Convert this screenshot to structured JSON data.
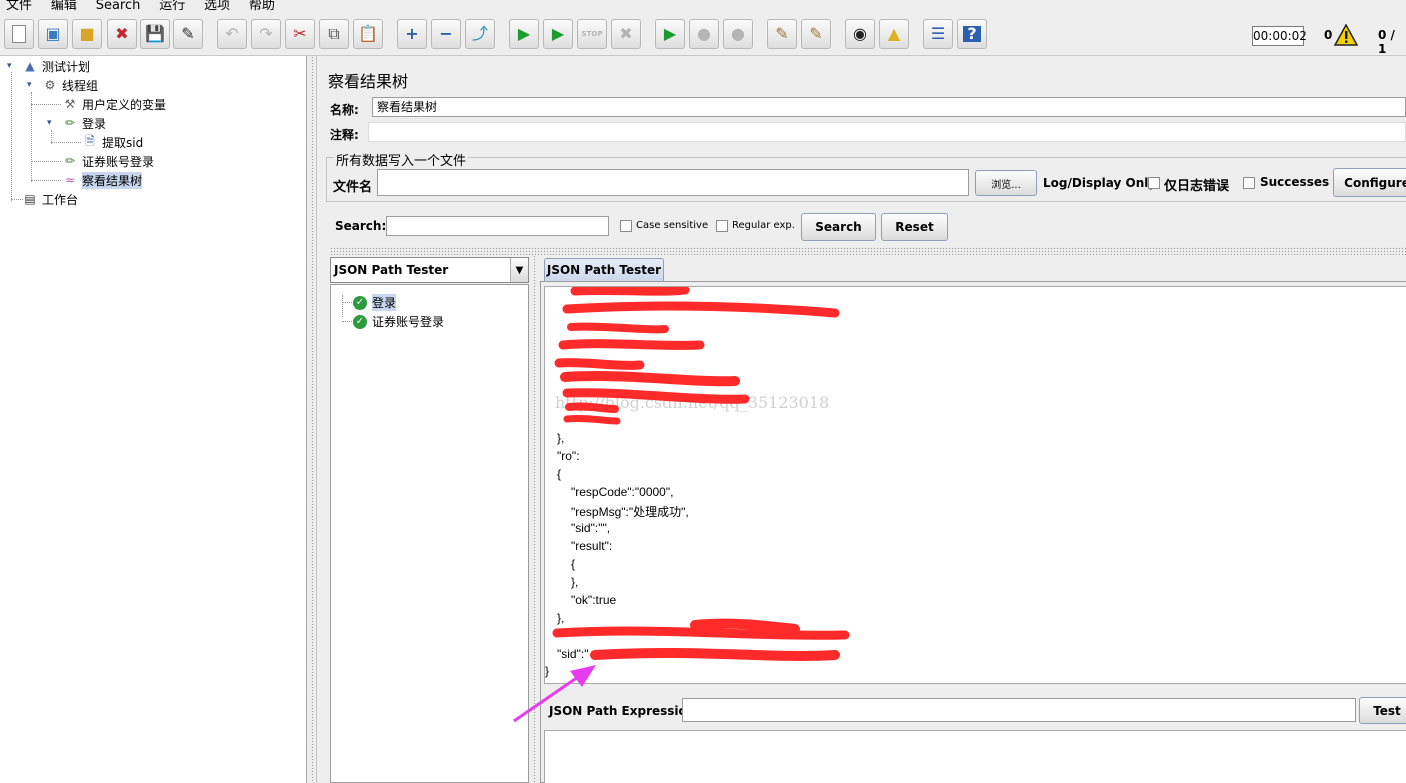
{
  "menu": [
    "文件",
    "编辑",
    "Search",
    "运行",
    "选项",
    "帮助"
  ],
  "toolbar": {
    "timer": "00:00:02",
    "error_count": "0",
    "threads": "0 / 1"
  },
  "tree": {
    "test_plan": "测试计划",
    "thread_group": "线程组",
    "user_vars": "用户定义的变量",
    "login": "登录",
    "extract_sid": "提取sid",
    "securities_login": "证券账号登录",
    "view_results_tree": "察看结果树",
    "workbench": "工作台"
  },
  "panel": {
    "title": "察看结果树",
    "name_label": "名称:",
    "name_value": "察看结果树",
    "comment_label": "注释:",
    "comment_value": "",
    "file_group_title": "所有数据写入一个文件",
    "filename_label": "文件名",
    "filename_value": "",
    "browse_label": "浏览...",
    "log_display_label": "Log/Display Only:",
    "errors_only_label": "仅日志错误",
    "successes_label": "Successes",
    "configure_label": "Configure"
  },
  "search": {
    "label": "Search:",
    "value": "",
    "case_sensitive_label": "Case sensitive",
    "regex_label": "Regular exp.",
    "search_button": "Search",
    "reset_button": "Reset"
  },
  "renderer": {
    "selected": "JSON Path Tester"
  },
  "samples": [
    {
      "label": "登录"
    },
    {
      "label": "证券账号登录"
    }
  ],
  "tab": {
    "label": "JSON Path Tester"
  },
  "json_lines": [
    "},",
    "\"ro\":",
    "{",
    "\"respCode\":\"0000\",",
    "\"respMsg\":\"处理成功\",",
    "\"sid\":\"\",",
    "\"result\":",
    "{",
    "},",
    "\"ok\":true",
    "},",
    "\"sid\":\"",
    "}"
  ],
  "watermark": "http://blog.csdn.net/qq_35123018",
  "expression": {
    "label": "JSON Path Expression",
    "value": "",
    "test_button": "Test"
  },
  "colors": {
    "redaction": "#ff2a2a",
    "annotation_arrow": "#e63cf0",
    "selection": "#c7d7ef",
    "success": "#2d9a3b"
  }
}
